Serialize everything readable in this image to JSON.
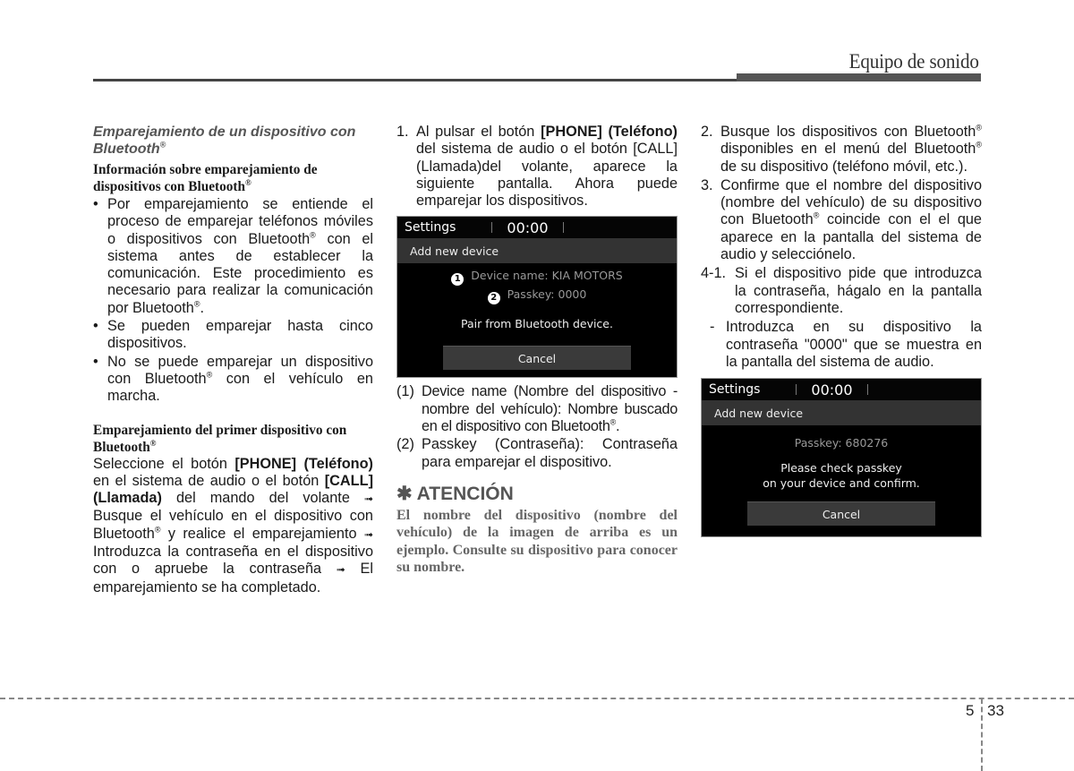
{
  "header": {
    "section_title": "Equipo de sonido"
  },
  "col1": {
    "heading_italic": "Emparejamiento de un dispositivo con Bluetooth",
    "reg": "®",
    "info_heading": "Información sobre emparejamiento de dispositivos con Bluetooth",
    "bullets": [
      {
        "pre": "Por emparejamiento se entiende el proceso de emparejar teléfonos móviles o dispositivos con Bluetooth",
        "mid": "con el sistema antes de establecer la comunicación. Este procedimiento es necesario para realizar la comunicación por Bluetooth",
        "post": "."
      },
      {
        "text": "Se pueden emparejar hasta cinco dispositivos."
      },
      {
        "pre": "No se puede emparejar un dispositivo con Bluetooth",
        "post": " con el vehículo en marcha."
      }
    ],
    "first_pair_heading": "Emparejamiento del primer dispositivo con Bluetooth",
    "procedure": {
      "p1": "Seleccione el botón ",
      "b1": "[PHONE] (Teléfono)",
      "p2": " en el sistema de audio o el botón ",
      "b2": "[CALL] (Llamada)",
      "p3": " del mando del volante ",
      "p4": " Busque el vehículo en el dispositivo con Bluetooth",
      "p5": " y realice el emparejamiento ",
      "p6": " Introduzca la contraseña en el dispositivo con o apruebe la contraseña ",
      "p7": " El emparejamiento se ha completado.",
      "arrow": "➟"
    }
  },
  "col2": {
    "step1": {
      "num": "1.",
      "pre": "Al pulsar el botón ",
      "bold": "[PHONE] (Teléfono)",
      "post": " del sistema de audio o el botón [CALL] (Llamada)del volante, aparece la siguiente pantalla. Ahora puede emparejar los dispositivos."
    },
    "screen1": {
      "topbar_label": "Settings",
      "clock": "00:00",
      "title": "Add new device",
      "marker1": "1",
      "line1": "Device name: KIA MOTORS",
      "marker2": "2",
      "line2": "Passkey: 0000",
      "message": "Pair from Bluetooth device.",
      "cancel": "Cancel"
    },
    "notes": [
      {
        "num": "(1)",
        "text": "Device name (Nombre del dispositivo - nombre del vehículo): Nombre buscado en el dispositivo con Bluetooth",
        "post": "."
      },
      {
        "num": "(2)",
        "text": "Passkey (Contraseña): Contraseña para emparejar el dispositivo."
      }
    ],
    "attention": {
      "icon": "✱",
      "title": "ATENCIÓN",
      "body": "El nombre del dispositivo (nombre del vehículo) de la imagen de arriba es un ejemplo. Consulte su dispositivo para conocer su nombre."
    }
  },
  "col3": {
    "step2": {
      "num": "2.",
      "pre": "Busque los dispositivos con Bluetooth",
      "mid": " disponibles en el menú del Bluetooth",
      "post": " de su dispositivo (teléfono móvil, etc.)."
    },
    "step3": {
      "num": "3.",
      "pre": "Confirme que el nombre del dispositivo (nombre del vehículo) de su dispositivo con Bluetooth",
      "post": " coincide con el el que aparece en la pantalla del sistema de audio y selecciónelo."
    },
    "step41": {
      "num": "4-1.",
      "text": "Si el dispositivo pide que introduzca la contraseña, hágalo en la pantalla correspondiente."
    },
    "step41_sub": {
      "num": "-",
      "text": "Introduzca en su dispositivo la contraseña \"0000\" que se muestra en la pantalla del sistema de audio."
    },
    "screen2": {
      "topbar_label": "Settings",
      "clock": "00:00",
      "title": "Add new device",
      "passkey": "Passkey: 680276",
      "message_line1": "Please check passkey",
      "message_line2": "on your device and confirm.",
      "cancel": "Cancel"
    }
  },
  "footer": {
    "chapter": "5",
    "page": "33"
  }
}
